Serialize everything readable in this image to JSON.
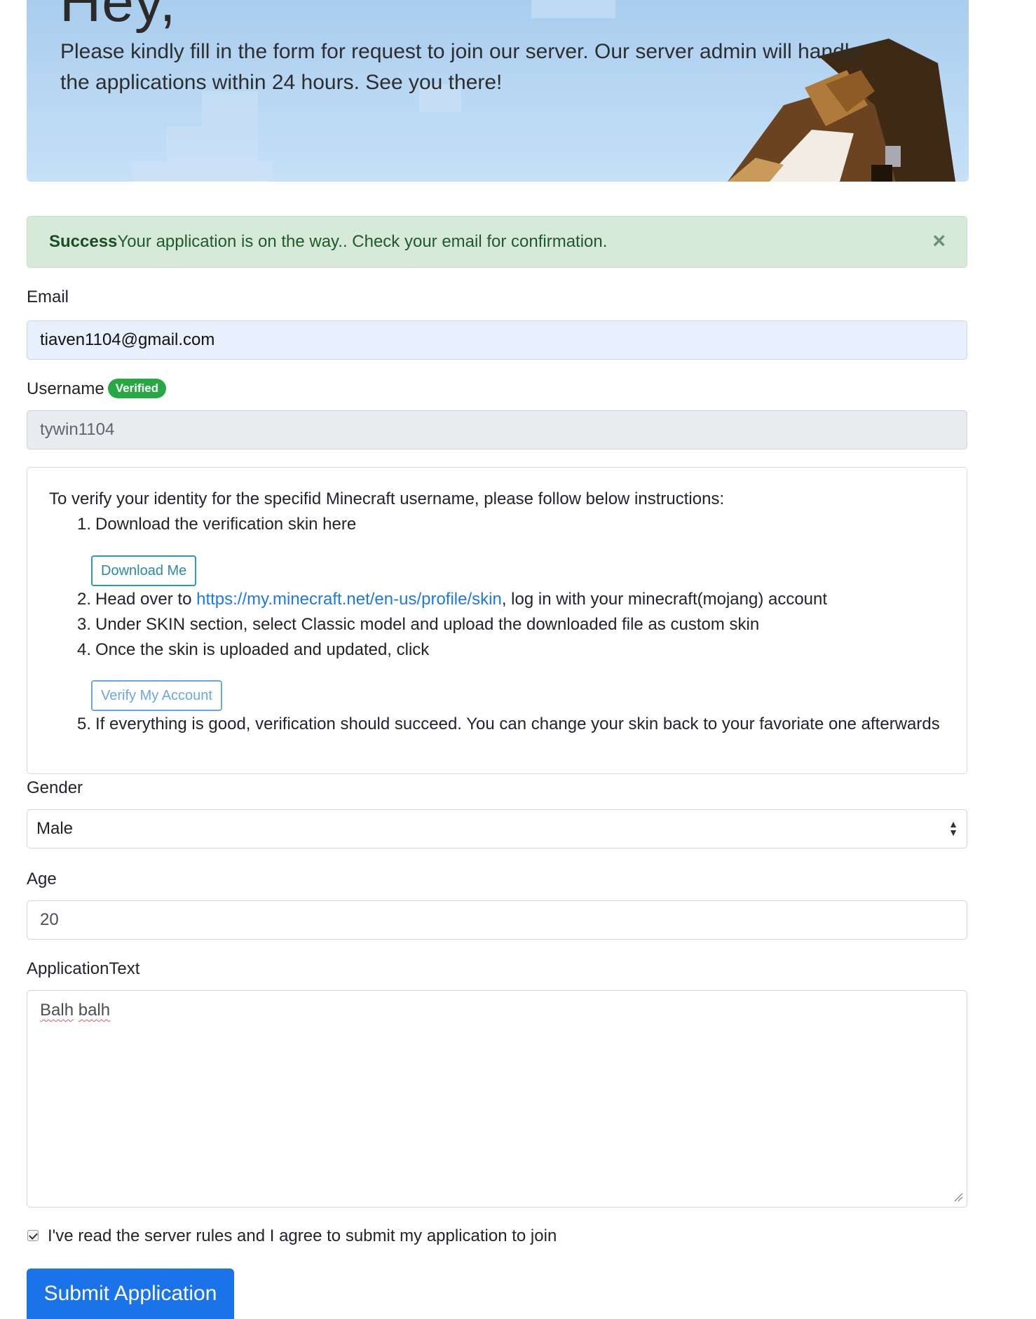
{
  "hero": {
    "title": "Hey,",
    "text": "Please kindly fill in the form for request to join our server. Our server admin will handle the applications within 24 hours. See you there!"
  },
  "alert": {
    "title": "Success",
    "message": "Your application is on the way.. Check your email for confirmation.",
    "close_glyph": "×"
  },
  "email": {
    "label": "Email",
    "value": "tiaven1104@gmail.com"
  },
  "username": {
    "label": "Username",
    "badge": "Verified",
    "value": "tywin1104"
  },
  "instructions": {
    "intro": "To verify your identity for the specifid Minecraft username, please follow below instructions:",
    "steps": [
      {
        "num": "1.",
        "text": "Download the verification skin here"
      },
      {
        "num": "2.",
        "before": "Head over to ",
        "link": "https://my.minecraft.net/en-us/profile/skin",
        "after": ", log in with your minecraft(mojang) account"
      },
      {
        "num": "3.",
        "text": "Under SKIN section, select Classic model and upload the downloaded file as custom skin"
      },
      {
        "num": "4.",
        "text": "Once the skin is uploaded and updated, click"
      },
      {
        "num": "5.",
        "text": "If everything is good, verification should succeed. You can change your skin back to your favoriate one afterwards"
      }
    ],
    "download_button": "Download Me",
    "verify_button": "Verify My Account"
  },
  "gender": {
    "label": "Gender",
    "selected": "Male"
  },
  "age": {
    "label": "Age",
    "value": "20"
  },
  "application": {
    "label": "ApplicationText",
    "word1": "Balh",
    "word2": "balh"
  },
  "agree": {
    "label": "I've read the server rules and I agree to submit my application to join",
    "checked": true
  },
  "submit": {
    "label": "Submit Application"
  },
  "colors": {
    "primary": "#1a73e8",
    "success": "#28a745",
    "alert_bg": "#d7ead9",
    "info": "#2a9bb0",
    "link": "#1f7ae0"
  },
  "icons": {
    "alert_close": "close-icon",
    "select_arrows": "select-arrows-icon",
    "resize": "resize-grip-icon"
  }
}
